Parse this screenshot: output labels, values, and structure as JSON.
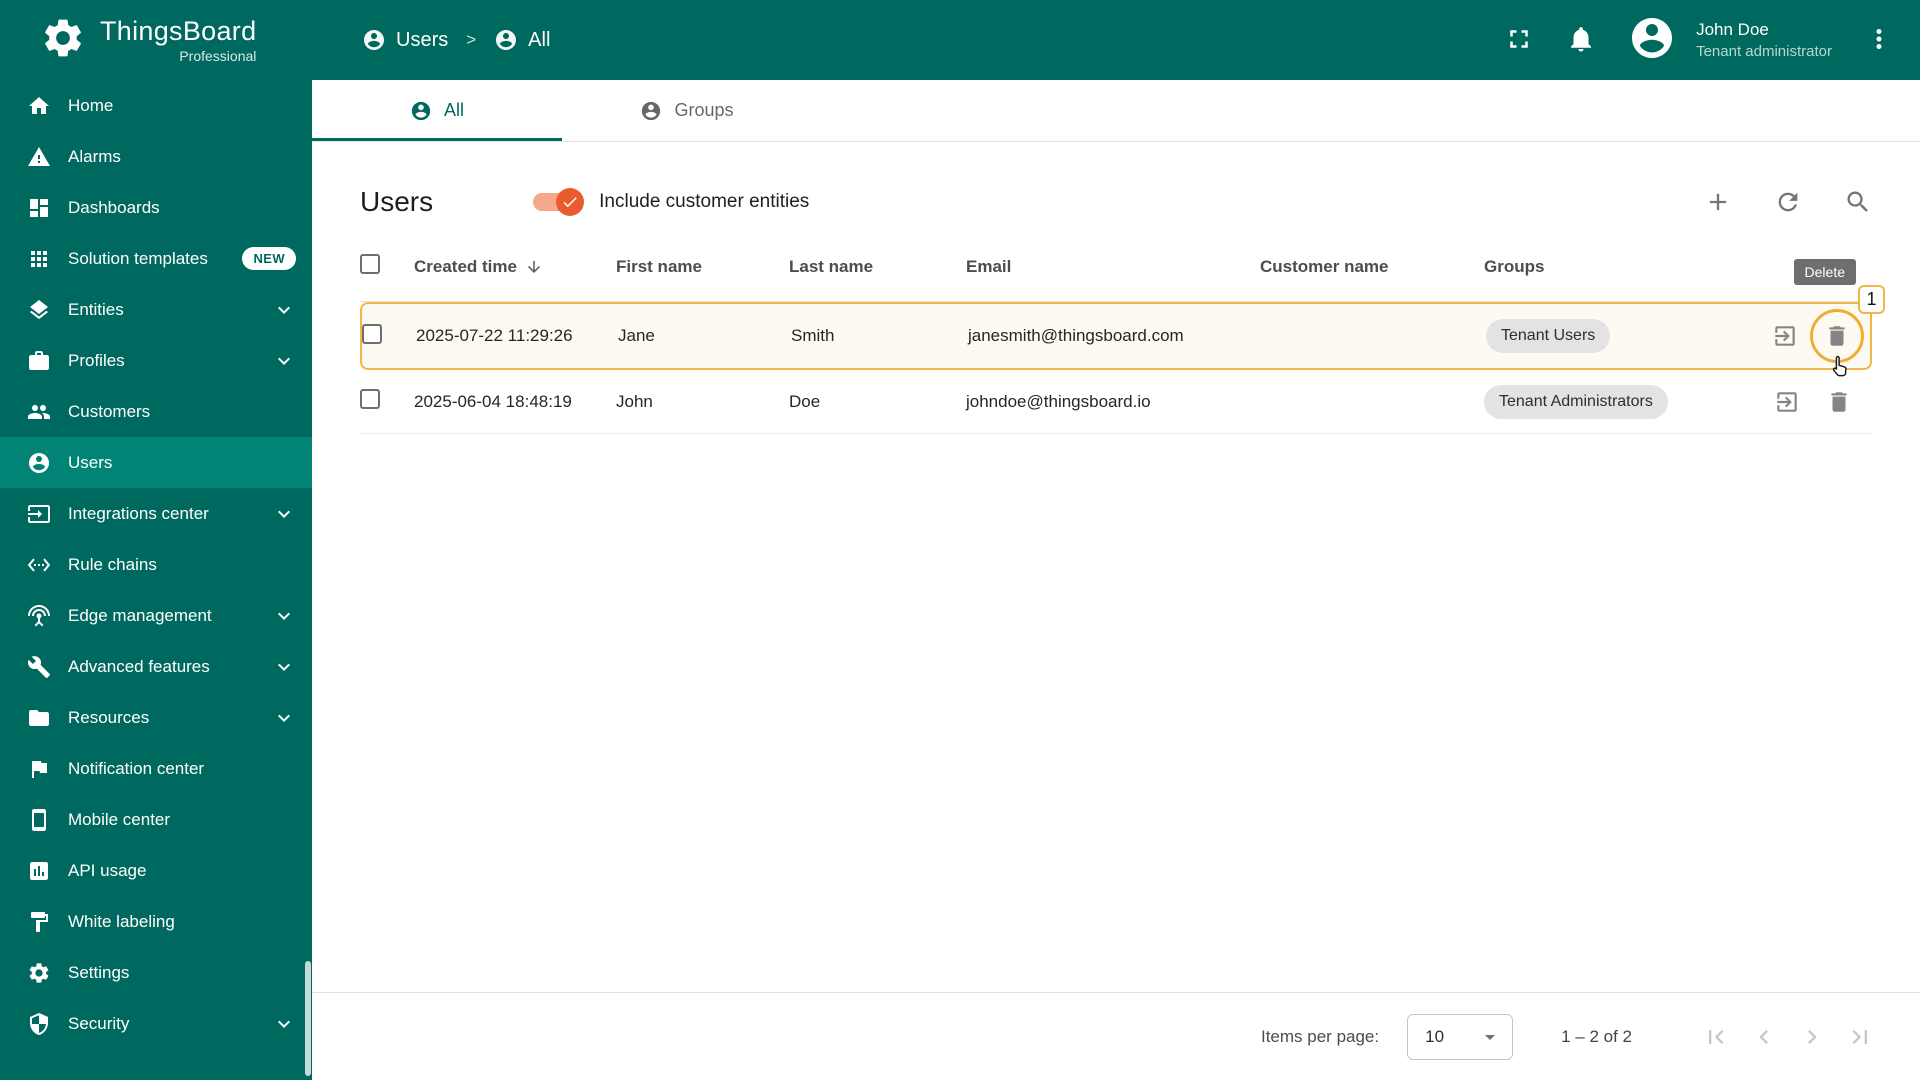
{
  "header": {
    "logo_title": "ThingsBoard",
    "logo_subtitle": "Professional",
    "breadcrumb": {
      "items": [
        "Users",
        "All"
      ],
      "separator": ">"
    },
    "user": {
      "name": "John Doe",
      "role": "Tenant administrator"
    }
  },
  "sidebar": {
    "items": [
      {
        "label": "Home"
      },
      {
        "label": "Alarms"
      },
      {
        "label": "Dashboards"
      },
      {
        "label": "Solution templates",
        "badge": "NEW"
      },
      {
        "label": "Entities",
        "expandable": true
      },
      {
        "label": "Profiles",
        "expandable": true
      },
      {
        "label": "Customers"
      },
      {
        "label": "Users",
        "active": true
      },
      {
        "label": "Integrations center",
        "expandable": true
      },
      {
        "label": "Rule chains"
      },
      {
        "label": "Edge management",
        "expandable": true
      },
      {
        "label": "Advanced features",
        "expandable": true
      },
      {
        "label": "Resources",
        "expandable": true
      },
      {
        "label": "Notification center"
      },
      {
        "label": "Mobile center"
      },
      {
        "label": "API usage"
      },
      {
        "label": "White labeling"
      },
      {
        "label": "Settings"
      },
      {
        "label": "Security",
        "expandable": true
      }
    ]
  },
  "tabs": [
    {
      "label": "All",
      "active": true
    },
    {
      "label": "Groups",
      "active": false
    }
  ],
  "content": {
    "title": "Users",
    "toggle_label": "Include customer entities",
    "toggle_on": true
  },
  "table": {
    "headers": [
      "Created time",
      "First name",
      "Last name",
      "Email",
      "Customer name",
      "Groups"
    ],
    "rows": [
      {
        "created_time": "2025-07-22 11:29:26",
        "first_name": "Jane",
        "last_name": "Smith",
        "email": "janesmith@thingsboard.com",
        "customer_name": "",
        "group": "Tenant Users",
        "highlighted": true
      },
      {
        "created_time": "2025-06-04 18:48:19",
        "first_name": "John",
        "last_name": "Doe",
        "email": "johndoe@thingsboard.io",
        "customer_name": "",
        "group": "Tenant Administrators",
        "highlighted": false
      }
    ]
  },
  "annotation": {
    "tooltip": "Delete",
    "step": "1"
  },
  "pagination": {
    "items_per_page_label": "Items per page:",
    "items_per_page": "10",
    "range": "1 – 2 of 2"
  },
  "colors": {
    "primary": "#00695f",
    "sidebar_active": "#018376",
    "toggle_accent": "#ea5c2d",
    "highlight": "#f1b648",
    "tooltip_bg": "#6e6e6e"
  }
}
